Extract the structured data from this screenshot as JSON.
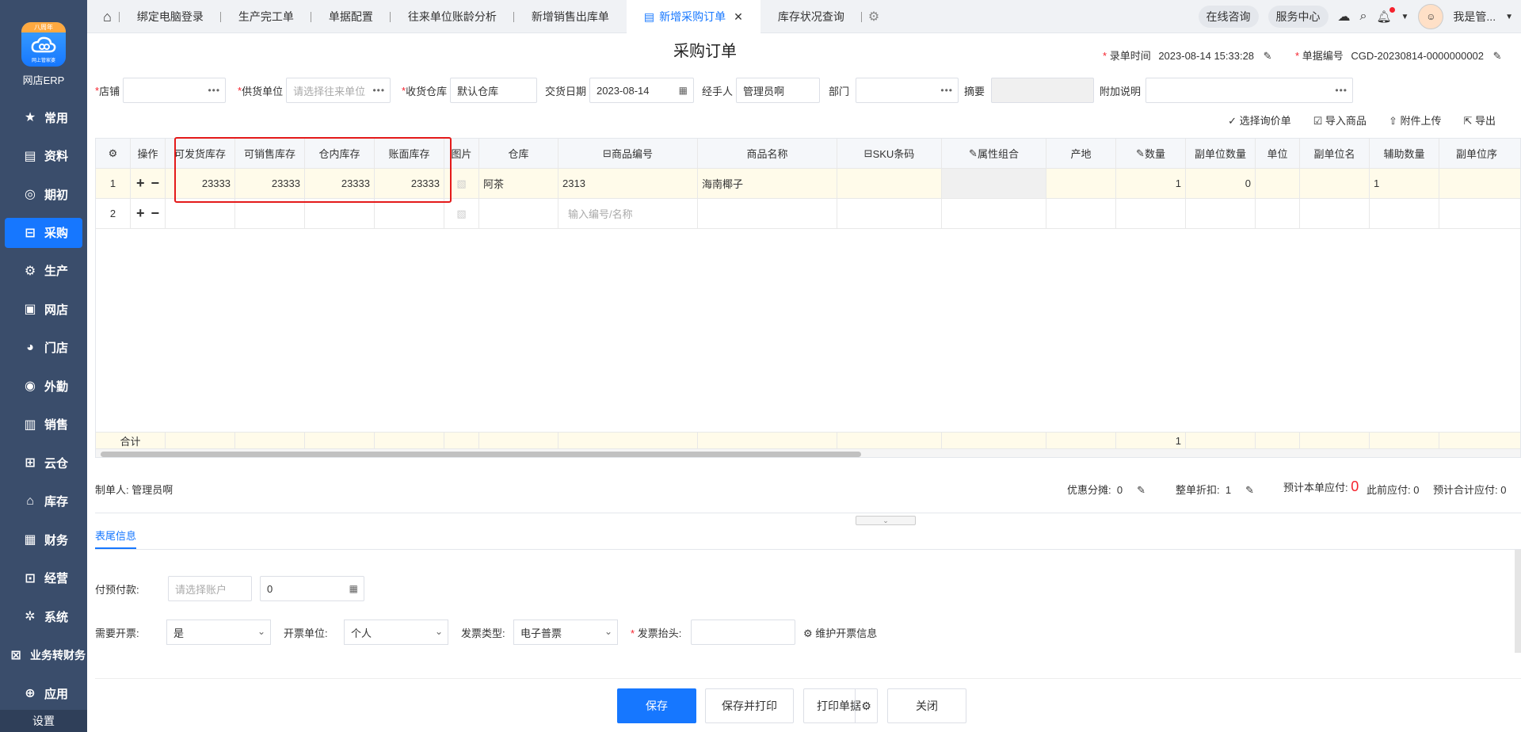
{
  "app": {
    "logo_ribbon": "八周年",
    "logo_mini": "网上管家婆",
    "brand": "网店ERP"
  },
  "sidebar": {
    "items": [
      {
        "label": "常用",
        "icon": "star-icon"
      },
      {
        "label": "资料",
        "icon": "document-icon"
      },
      {
        "label": "期初",
        "icon": "target-icon"
      },
      {
        "label": "采购",
        "icon": "cart-icon"
      },
      {
        "label": "生产",
        "icon": "factory-icon"
      },
      {
        "label": "网店",
        "icon": "shop-icon"
      },
      {
        "label": "门店",
        "icon": "pie-icon"
      },
      {
        "label": "外勤",
        "icon": "compass-icon"
      },
      {
        "label": "销售",
        "icon": "chart-icon"
      },
      {
        "label": "云仓",
        "icon": "cloud-warehouse-icon"
      },
      {
        "label": "库存",
        "icon": "home-icon"
      },
      {
        "label": "财务",
        "icon": "wallet-icon"
      },
      {
        "label": "经营",
        "icon": "trend-icon"
      },
      {
        "label": "系统",
        "icon": "gear-icon"
      },
      {
        "label": "业务转财务",
        "icon": "transfer-icon"
      },
      {
        "label": "应用",
        "icon": "plus-icon"
      }
    ],
    "active_index": 3,
    "settings": "设置"
  },
  "tabs": [
    "绑定电脑登录",
    "生产完工单",
    "单据配置",
    "往来单位账龄分析",
    "新增销售出库单",
    "新增采购订单",
    "库存状况查询"
  ],
  "active_tab": 5,
  "top_right": {
    "consult": "在线咨询",
    "service": "服务中心",
    "user": "我是管..."
  },
  "page": {
    "title": "采购订单",
    "entry_time_label": "录单时间",
    "entry_time": "2023-08-14 15:33:28",
    "doc_no_label": "单据编号",
    "doc_no": "CGD-20230814-0000000002"
  },
  "filters": {
    "store_label": "店铺",
    "store_value": "",
    "supplier_label": "供货单位",
    "supplier_placeholder": "请选择往来单位",
    "warehouse_label": "收货仓库",
    "warehouse_value": "默认仓库",
    "delivery_label": "交货日期",
    "delivery_value": "2023-08-14",
    "handler_label": "经手人",
    "handler_value": "管理员啊",
    "dept_label": "部门",
    "summary_label": "摘要",
    "note_label": "附加说明"
  },
  "actions": [
    "选择询价单",
    "导入商品",
    "附件上传",
    "导出"
  ],
  "table": {
    "headers": [
      "操作",
      "可发货库存",
      "可销售库存",
      "仓内库存",
      "账面库存",
      "图片",
      "仓库",
      "商品编号",
      "商品名称",
      "SKU条码",
      "属性组合",
      "产地",
      "数量",
      "副单位数量",
      "单位",
      "副单位名",
      "辅助数量",
      "副单位序"
    ],
    "rows": [
      {
        "no": "1",
        "avail_ship": "23333",
        "avail_sale": "23333",
        "in_wh": "23333",
        "book": "23333",
        "warehouse": "阿茶",
        "code": "2313",
        "name": "海南椰子",
        "qty": "1",
        "sub_qty": "0",
        "aux_qty": "1"
      },
      {
        "no": "2",
        "code_placeholder": "输入编号/名称"
      }
    ],
    "sum_label": "合计",
    "sum_qty": "1"
  },
  "info": {
    "maker_label": "制单人:",
    "maker": "管理员啊",
    "discount_split_label": "优惠分摊:",
    "discount_split": "0",
    "whole_discount_label": "整单折扣:",
    "whole_discount": "1",
    "expected_label": "预计本单应付:",
    "expected": "0",
    "prev_label": "此前应付:",
    "prev": "0",
    "total_label": "预计合计应付:",
    "total": "0"
  },
  "tail": {
    "tab": "表尾信息",
    "prepay_label": "付预付款:",
    "account_placeholder": "请选择账户",
    "amount": "0",
    "invoice_need_label": "需要开票:",
    "invoice_need": "是",
    "invoice_unit_label": "开票单位:",
    "invoice_unit": "个人",
    "invoice_type_label": "发票类型:",
    "invoice_type": "电子普票",
    "invoice_title_label": "发票抬头:",
    "maintain": "维护开票信息"
  },
  "buttons": {
    "save": "保存",
    "save_print": "保存并打印",
    "print": "打印单据",
    "close": "关闭"
  }
}
